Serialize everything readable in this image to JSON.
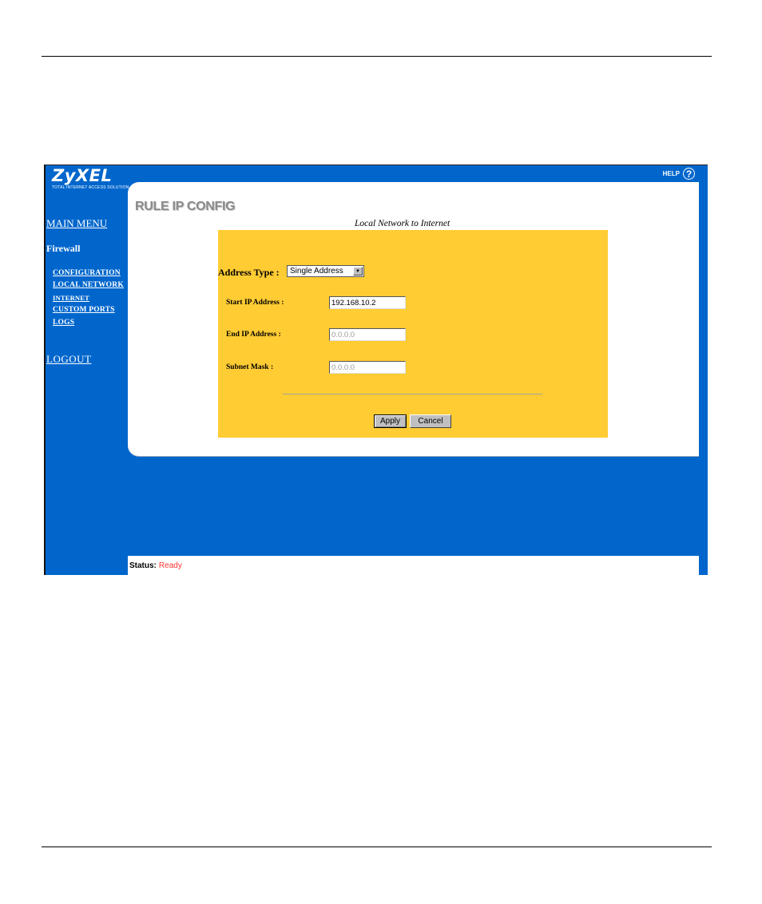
{
  "brand": {
    "name": "ZyXEL",
    "tagline": "Total Internet Access Solution"
  },
  "header": {
    "help_label": "HELP",
    "help_icon": "question-circle-icon",
    "help_glyph": "?"
  },
  "sidebar": {
    "main_menu": "MAIN MENU",
    "section_title": "Firewall",
    "items": [
      {
        "label": "CONFIGURATION"
      },
      {
        "label": "LOCAL NETWORK"
      },
      {
        "label": "INTERNET"
      },
      {
        "label": "CUSTOM PORTS"
      },
      {
        "label": "LOGS"
      }
    ],
    "logout": "LOGOUT"
  },
  "page": {
    "title": "RULE IP CONFIG",
    "subtitle": "Local Network to Internet"
  },
  "form": {
    "address_type_label": "Address Type :",
    "address_type_value": "Single Address",
    "address_type_arrow": "▼",
    "start_ip_label": "Start IP Address :",
    "start_ip_value": "192.168.10.2",
    "end_ip_label": "End IP Address :",
    "end_ip_value": "0.0.0.0",
    "subnet_label": "Subnet Mask :",
    "subnet_value": "0.0.0.0",
    "apply_label": "Apply",
    "cancel_label": "Cancel"
  },
  "status": {
    "label": "Status:",
    "value": "Ready"
  },
  "colors": {
    "frame_blue": "#0066cc",
    "form_yellow": "#ffcc33",
    "status_red": "#ff3333",
    "title_gray": "#8a8a8a"
  }
}
